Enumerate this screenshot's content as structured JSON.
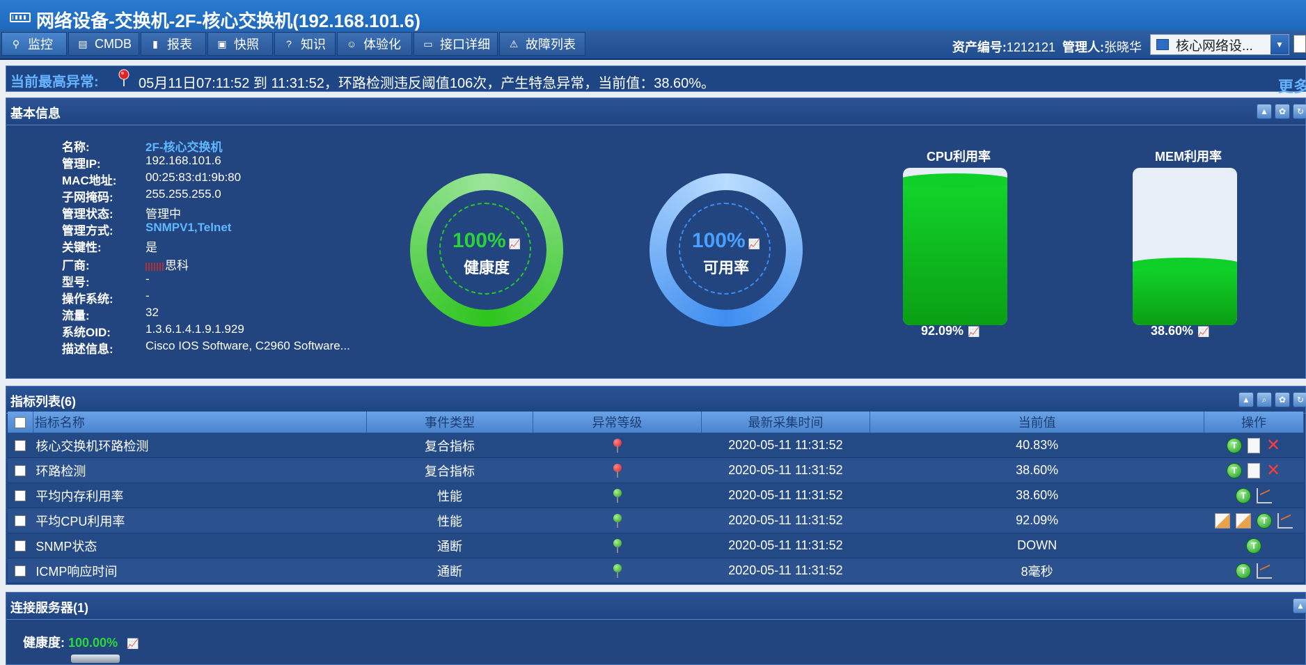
{
  "window": {
    "title": "网络设备-交换机-2F-核心交换机(192.168.101.6)"
  },
  "tabs": [
    {
      "label": "监控",
      "icon": "binoculars-icon"
    },
    {
      "label": "CMDB",
      "icon": "database-icon"
    },
    {
      "label": "报表",
      "icon": "bar-chart-icon"
    },
    {
      "label": "快照",
      "icon": "camera-icon"
    },
    {
      "label": "知识",
      "icon": "help-icon"
    },
    {
      "label": "体验化",
      "icon": "user-experience-icon"
    },
    {
      "label": "接口详细",
      "icon": "monitor-icon"
    },
    {
      "label": "故障列表",
      "icon": "warning-icon"
    }
  ],
  "asset": {
    "number_label": "资产编号:",
    "number": "1212121",
    "manager_label": "管理人:",
    "manager": "张晓华"
  },
  "group_select": {
    "value": "核心网络设..."
  },
  "alert": {
    "label": "当前最高异常:",
    "message": "05月11日07:11:52 到 11:31:52，环路检测违反阈值106次，产生特急异常，当前值：38.60%。",
    "more": "更多"
  },
  "basic": {
    "title": "基本信息",
    "fields": [
      {
        "key": "名称:",
        "value": "2F-核心交换机"
      },
      {
        "key": "管理IP:",
        "value": "192.168.101.6"
      },
      {
        "key": "MAC地址:",
        "value": "00:25:83:d1:9b:80"
      },
      {
        "key": "子网掩码:",
        "value": "255.255.255.0"
      },
      {
        "key": "管理状态:",
        "value": "管理中"
      },
      {
        "key": "管理方式:",
        "value": "SNMPV1,Telnet"
      },
      {
        "key": "关键性:",
        "value": "是"
      },
      {
        "key": "厂商:",
        "value": "思科"
      },
      {
        "key": "型号:",
        "value": "-"
      },
      {
        "key": "操作系统:",
        "value": "-"
      },
      {
        "key": "流量:",
        "value": "32"
      },
      {
        "key": "系统OID:",
        "value": "1.3.6.1.4.1.9.1.929"
      },
      {
        "key": "描述信息:",
        "value": "Cisco IOS Software, C2960 Software..."
      }
    ],
    "health": {
      "value": "100%",
      "label": "健康度"
    },
    "availability": {
      "value": "100%",
      "label": "可用率"
    },
    "cpu": {
      "title": "CPU利用率",
      "value": "92.09%",
      "level": 0.9209
    },
    "mem": {
      "title": "MEM利用率",
      "value": "38.60%",
      "level": 0.386
    }
  },
  "metrics": {
    "title": "指标列表(6)",
    "columns": [
      "指标名称",
      "事件类型",
      "异常等级",
      "最新采集时间",
      "当前值",
      "操作"
    ],
    "rows": [
      {
        "name": "核心交换机环路检测",
        "type": "复合指标",
        "level": "red",
        "time": "2020-05-11 11:31:52",
        "value": "40.83%",
        "ops": [
          "t",
          "note",
          "x"
        ]
      },
      {
        "name": "环路检测",
        "type": "复合指标",
        "level": "red",
        "time": "2020-05-11 11:31:52",
        "value": "38.60%",
        "ops": [
          "t",
          "note",
          "x"
        ]
      },
      {
        "name": "平均内存利用率",
        "type": "性能",
        "level": "green",
        "time": "2020-05-11 11:31:52",
        "value": "38.60%",
        "ops": [
          "t",
          "chart"
        ]
      },
      {
        "name": "平均CPU利用率",
        "type": "性能",
        "level": "green",
        "time": "2020-05-11 11:31:52",
        "value": "92.09%",
        "ops": [
          "img",
          "img",
          "t",
          "chart"
        ]
      },
      {
        "name": "SNMP状态",
        "type": "通断",
        "level": "green",
        "time": "2020-05-11 11:31:52",
        "value": "DOWN",
        "ops": [
          "t"
        ]
      },
      {
        "name": "ICMP响应时间",
        "type": "通断",
        "level": "green",
        "time": "2020-05-11 11:31:52",
        "value": "8毫秒",
        "ops": [
          "t",
          "chart"
        ]
      }
    ]
  },
  "servers": {
    "title": "连接服务器(1)",
    "health_label": "健康度:",
    "health_value": "100.00%"
  },
  "colors": {
    "accent": "#66b3ff",
    "ok_green": "#1cc92e",
    "alert_red": "#e02424",
    "panel_bg": "#22447f"
  }
}
